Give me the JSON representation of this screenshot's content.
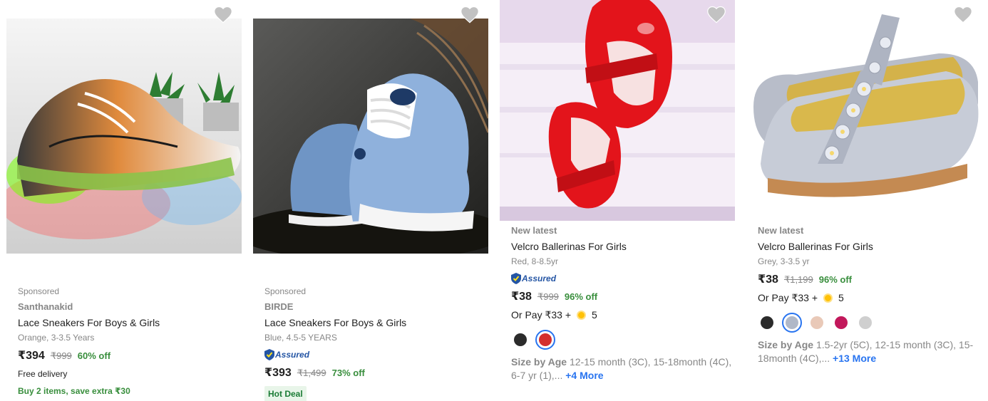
{
  "products": [
    {
      "sponsored": "Sponsored",
      "brand": "Santhanakid",
      "title": "Lace Sneakers For Boys & Girls",
      "variant": "Orange, 3-3.5 Years",
      "price": "₹394",
      "mrp": "₹999",
      "discount": "60% off",
      "delivery": "Free delivery",
      "offer": "Buy 2 items, save extra ₹30",
      "image_icon": "led-sneakers-image"
    },
    {
      "sponsored": "Sponsored",
      "brand": "BIRDE",
      "title": "Lace Sneakers For Boys & Girls",
      "variant": "Blue, 4.5-5 YEARS",
      "assured": "Assured",
      "price": "₹393",
      "mrp": "₹1,499",
      "discount": "73% off",
      "badge": "Hot Deal",
      "image_icon": "blue-sneakers-image"
    },
    {
      "label": "New latest",
      "title": "Velcro Ballerinas For Girls",
      "variant": "Red, 8-8.5yr",
      "assured": "Assured",
      "price": "₹38",
      "mrp": "₹999",
      "discount": "96% off",
      "pay_prefix": "Or Pay ₹33 +",
      "pay_coins": "5",
      "size_label": "Size by Age",
      "size_values": "12-15 month (3C), 15-18month (4C), 6-7 yr (1),...",
      "size_more": "+4 More",
      "swatch_colors": [
        "#2b2b2b",
        "#d32f2f"
      ],
      "image_icon": "red-ballerinas-image"
    },
    {
      "label": "New latest",
      "title": "Velcro Ballerinas For Girls",
      "variant": "Grey, 3-3.5 yr",
      "price": "₹38",
      "mrp": "₹1,199",
      "discount": "96% off",
      "pay_prefix": "Or Pay ₹33 +",
      "pay_coins": "5",
      "size_label": "Size by Age",
      "size_values": "1.5-2yr (5C), 12-15 month (3C), 15-18month (4C),...",
      "size_more": "+13 More",
      "swatch_colors": [
        "#2b2b2b",
        "#b0b8c8",
        "#e9c9b8",
        "#c2185b",
        "#cfcfcf"
      ],
      "image_icon": "grey-ballerinas-image"
    }
  ],
  "colors": {
    "price_green": "#388e3c",
    "link_blue": "#2874f0",
    "assured_blue": "#2455a4",
    "muted": "#878787"
  }
}
